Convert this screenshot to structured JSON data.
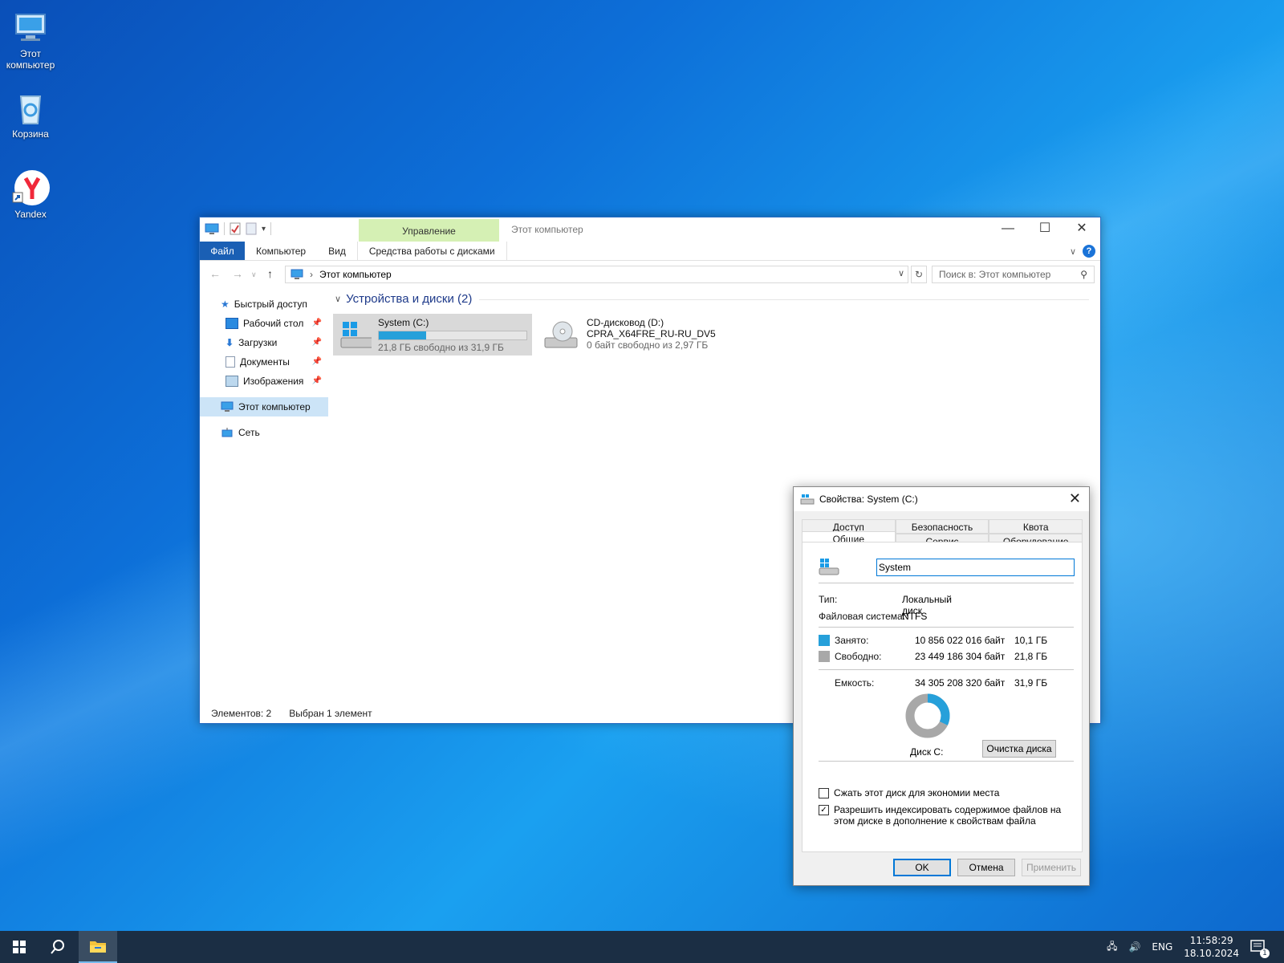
{
  "desktop": {
    "icons": [
      {
        "label": "Этот компьютер",
        "icon": "computer-icon"
      },
      {
        "label": "Корзина",
        "icon": "recycle-bin-icon"
      },
      {
        "label": "Yandex",
        "icon": "yandex-browser-icon"
      }
    ]
  },
  "explorer": {
    "context_tab": "Управление",
    "title": "Этот компьютер",
    "ribbon_tabs": [
      "Файл",
      "Компьютер",
      "Вид",
      "Средства работы с дисками"
    ],
    "address": "Этот компьютер",
    "search_placeholder": "Поиск в: Этот компьютер",
    "nav": {
      "quick_access": "Быстрый доступ",
      "items": [
        "Рабочий стол",
        "Загрузки",
        "Документы",
        "Изображения"
      ],
      "this_pc": "Этот компьютер",
      "network": "Сеть"
    },
    "group_header": "Устройства и диски (2)",
    "drives": [
      {
        "name": "System (C:)",
        "free_text": "21,8 ГБ свободно из 31,9 ГБ",
        "used_fraction": 0.32
      },
      {
        "name": "CD-дисковод (D:)",
        "label": "CPRA_X64FRE_RU-RU_DV5",
        "free_text": "0 байт свободно из 2,97 ГБ"
      }
    ],
    "status": {
      "items": "Элементов: 2",
      "selected": "Выбран 1 элемент"
    }
  },
  "dialog": {
    "title": "Свойства: System (C:)",
    "tabs_top": [
      "Доступ",
      "Безопасность",
      "Квота"
    ],
    "tabs_bottom": [
      "Общие",
      "Сервис",
      "Оборудование"
    ],
    "active_tab": "Общие",
    "name_value": "System",
    "type_label": "Тип:",
    "type_value": "Локальный диск",
    "fs_label": "Файловая система:",
    "fs_value": "NTFS",
    "used_label": "Занято:",
    "used_bytes": "10 856 022 016 байт",
    "used_gb": "10,1 ГБ",
    "free_label": "Свободно:",
    "free_bytes": "23 449 186 304 байт",
    "free_gb": "21,8 ГБ",
    "cap_label": "Емкость:",
    "cap_bytes": "34 305 208 320 байт",
    "cap_gb": "31,9 ГБ",
    "disk_label": "Диск C:",
    "cleanup_button": "Очистка диска",
    "compress_label": "Сжать этот диск для экономии места",
    "compress_checked": false,
    "index_label": "Разрешить индексировать содержимое файлов на этом диске в дополнение к свойствам файла",
    "index_checked": true,
    "ok": "OK",
    "cancel": "Отмена",
    "apply": "Применить",
    "used_color": "#26a0da",
    "free_color": "#a8a8a8"
  },
  "taskbar": {
    "lang": "ENG",
    "time": "11:58:29",
    "date": "18.10.2024",
    "notifications": "1"
  }
}
